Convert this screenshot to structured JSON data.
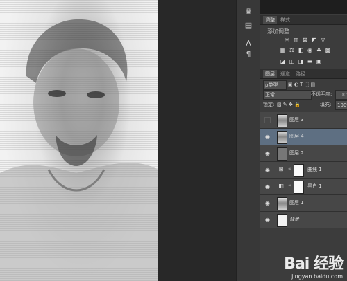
{
  "right_panel": {
    "adjust_tabs": [
      {
        "label": "调整",
        "active": true
      },
      {
        "label": "样式",
        "active": false
      }
    ],
    "adjust_title": "添加调整",
    "layers_tabs": [
      {
        "label": "图层",
        "active": true
      },
      {
        "label": "通道",
        "active": false
      },
      {
        "label": "路径",
        "active": false
      }
    ],
    "filter_kind": "ρ类型",
    "blend_mode": "正常",
    "opacity_label": "不透明度:",
    "opacity_value": "100%",
    "lock_label": "锁定:",
    "fill_label": "填充:",
    "fill_value": "100%"
  },
  "layers": [
    {
      "name": "图层 3",
      "visible": false,
      "thumb": "photo",
      "selected": false
    },
    {
      "name": "图层 4",
      "visible": true,
      "thumb": "photo",
      "selected": true
    },
    {
      "name": "图层 2",
      "visible": true,
      "thumb": "gray",
      "selected": false
    },
    {
      "name": "曲线 1",
      "visible": true,
      "thumb": "curves-adjustment",
      "mask": true,
      "selected": false
    },
    {
      "name": "黑白 1",
      "visible": true,
      "thumb": "black-white-adjustment",
      "mask": true,
      "selected": false
    },
    {
      "name": "图层 1",
      "visible": true,
      "thumb": "photo",
      "selected": false
    },
    {
      "name": "背景",
      "visible": true,
      "thumb": "white",
      "selected": false,
      "italic": true
    }
  ],
  "watermark": {
    "logo": "Bai 经验",
    "url": "jingyan.baidu.com"
  },
  "colors": {
    "selected_row": "#5e6f82",
    "panel": "#3c3c3c",
    "canvas_bg": "#282828"
  }
}
